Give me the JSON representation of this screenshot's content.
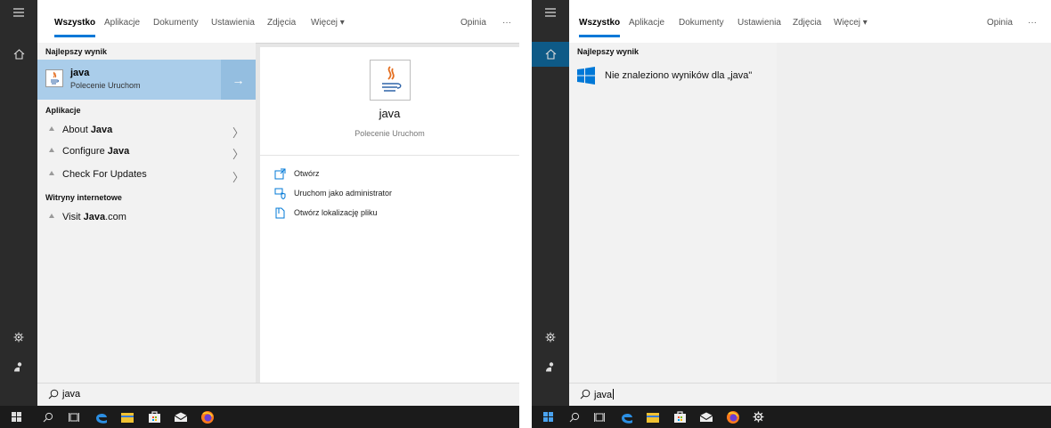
{
  "tabs": {
    "all": "Wszystko",
    "apps": "Aplikacje",
    "documents": "Dokumenty",
    "settings": "Ustawienia",
    "photos": "Zdjęcia",
    "more": "Więcej ▾",
    "feedback": "Opinia",
    "overflow": "···"
  },
  "left": {
    "best_header": "Najlepszy wynik",
    "best": {
      "name": "java",
      "subtitle": "Polecenie Uruchom"
    },
    "apps_header": "Aplikacje",
    "apps": [
      {
        "prefix": "About ",
        "bold": "Java",
        "suffix": ""
      },
      {
        "prefix": "Configure ",
        "bold": "Java",
        "suffix": ""
      },
      {
        "prefix": "Check For Updates",
        "bold": "",
        "suffix": ""
      }
    ],
    "web_header": "Witryny internetowe",
    "web": [
      {
        "prefix": "Visit ",
        "bold": "Java",
        "suffix": ".com"
      }
    ],
    "detail": {
      "title": "java",
      "subtitle": "Polecenie Uruchom",
      "actions": [
        "Otwórz",
        "Uruchom jako administrator",
        "Otwórz lokalizację pliku"
      ]
    },
    "search_query": "java"
  },
  "right": {
    "best_header": "Najlepszy wynik",
    "no_results": "Nie znaleziono wyników dla „java\"",
    "search_query": "java"
  },
  "colors": {
    "accent": "#0078d7",
    "selected_bg": "#aacdea",
    "sidebar": "#2b2b2b",
    "taskbar": "#1b1b1b"
  }
}
